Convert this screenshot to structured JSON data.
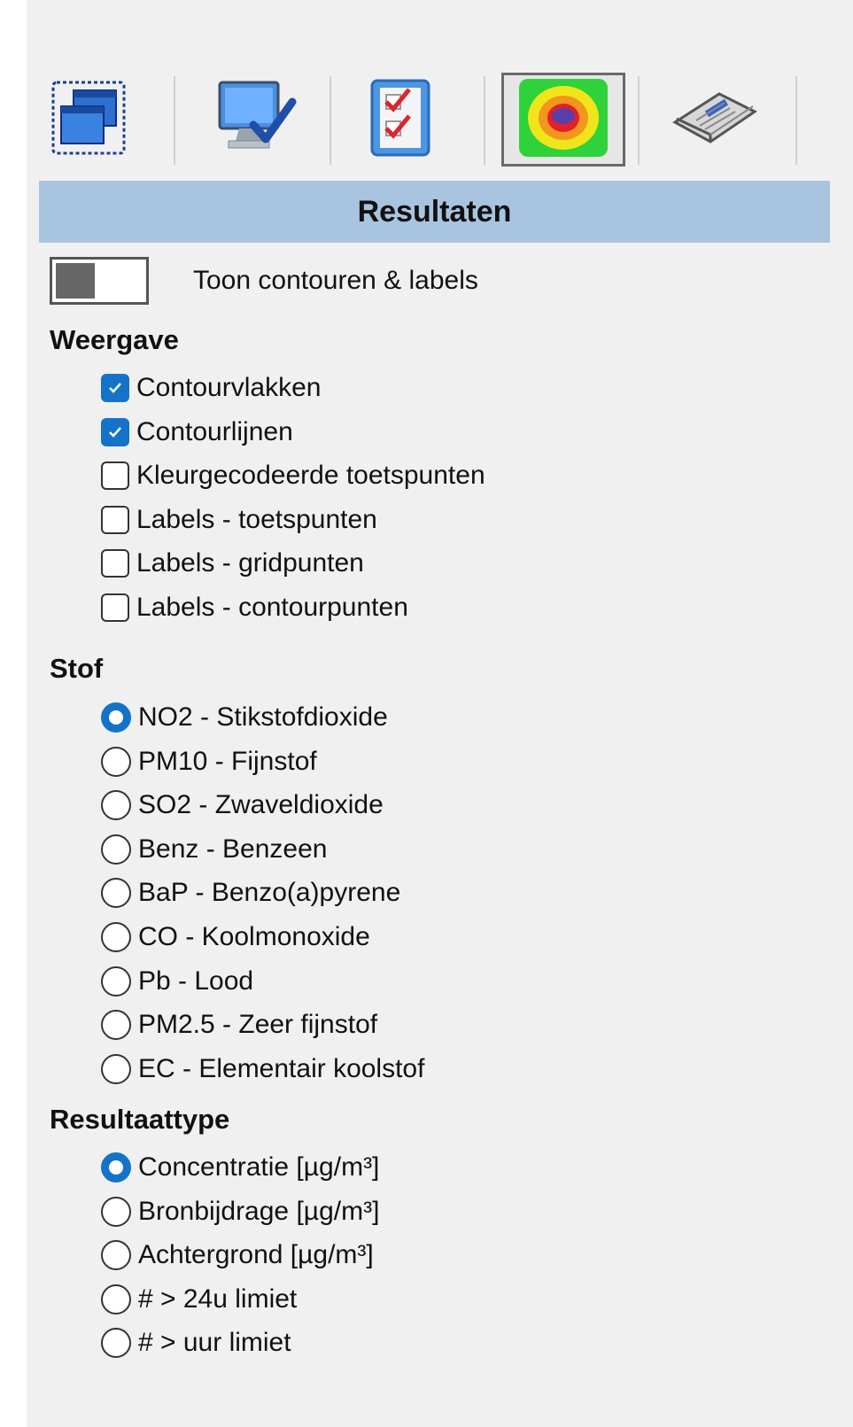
{
  "toolbar": {
    "buttons": [
      {
        "icon": "window-select-icon"
      },
      {
        "icon": "monitor-check-icon"
      },
      {
        "icon": "checklist-icon"
      },
      {
        "icon": "contour-target-icon",
        "active": true
      },
      {
        "icon": "newspaper-icon"
      }
    ]
  },
  "header": {
    "title": "Resultaten"
  },
  "toggle": {
    "label": "Toon contouren & labels"
  },
  "weergave": {
    "title": "Weergave",
    "options": [
      {
        "label": "Contourvlakken",
        "checked": true
      },
      {
        "label": "Contourlijnen",
        "checked": true
      },
      {
        "label": "Kleurgecodeerde toetspunten",
        "checked": false
      },
      {
        "label": "Labels - toetspunten",
        "checked": false
      },
      {
        "label": "Labels - gridpunten",
        "checked": false
      },
      {
        "label": "Labels - contourpunten",
        "checked": false
      }
    ]
  },
  "stof": {
    "title": "Stof",
    "options": [
      {
        "label": "NO2 - Stikstofdioxide",
        "selected": true
      },
      {
        "label": "PM10 - Fijnstof",
        "selected": false
      },
      {
        "label": "SO2 - Zwaveldioxide",
        "selected": false
      },
      {
        "label": "Benz - Benzeen",
        "selected": false
      },
      {
        "label": "BaP - Benzo(a)pyrene",
        "selected": false
      },
      {
        "label": "CO - Koolmonoxide",
        "selected": false
      },
      {
        "label": "Pb - Lood",
        "selected": false
      },
      {
        "label": "PM2.5 - Zeer fijnstof",
        "selected": false
      },
      {
        "label": "EC - Elementair koolstof",
        "selected": false
      }
    ]
  },
  "resultaattype": {
    "title": "Resultaattype",
    "options": [
      {
        "label": "Concentratie [µg/m³]",
        "selected": true
      },
      {
        "label": "Bronbijdrage [µg/m³]",
        "selected": false
      },
      {
        "label": "Achtergrond [µg/m³]",
        "selected": false
      },
      {
        "label": "# > 24u limiet",
        "selected": false
      },
      {
        "label": "# > uur limiet",
        "selected": false
      }
    ]
  },
  "colors": {
    "header_bg": "#a9c4de",
    "accent": "#1473c9",
    "panel_bg": "#f0f0f0"
  }
}
